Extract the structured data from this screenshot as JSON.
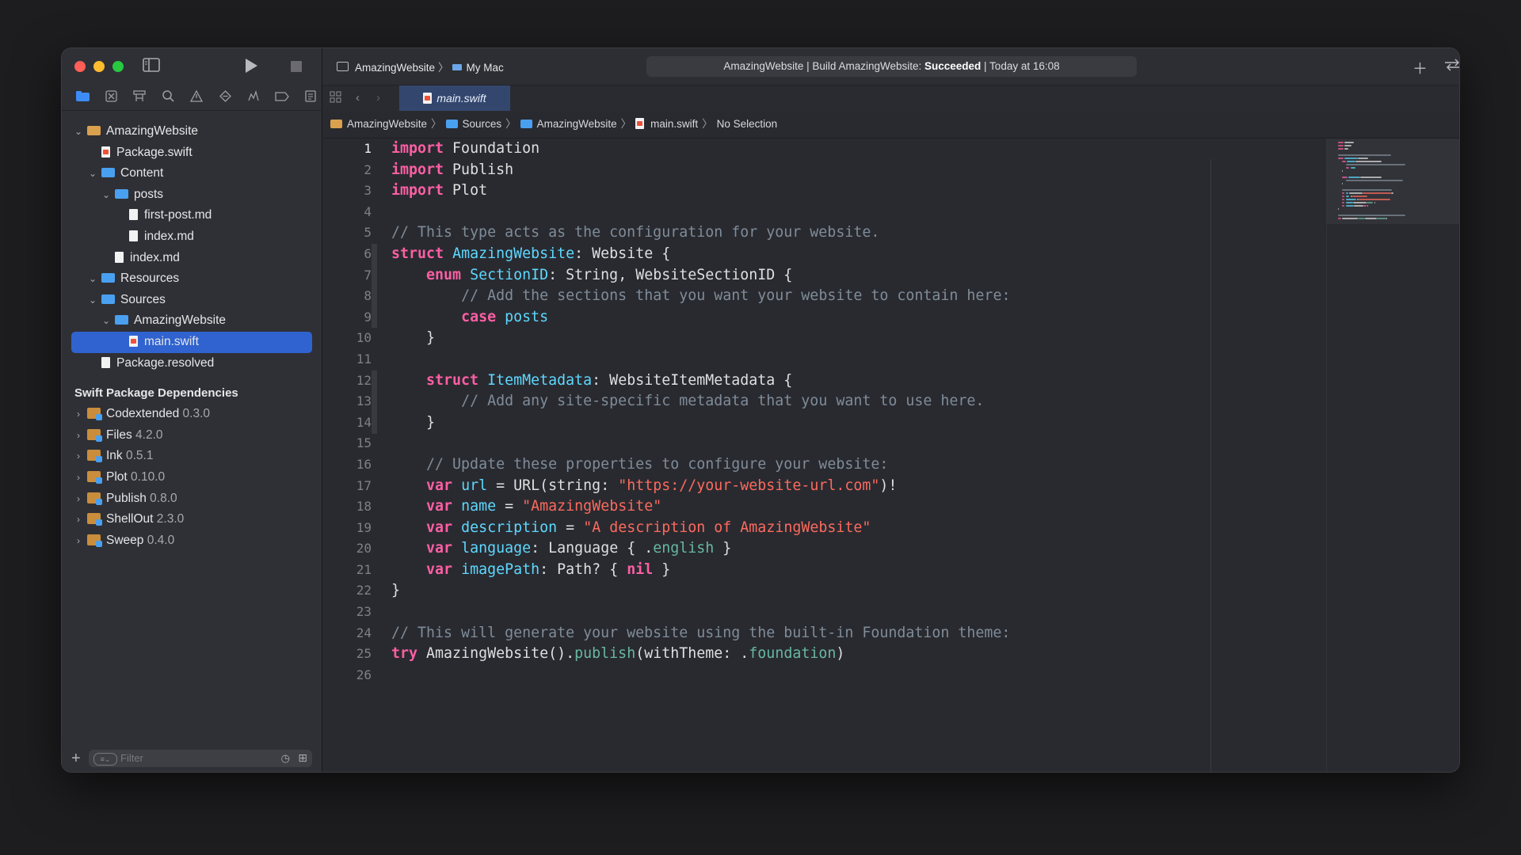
{
  "toolbar": {
    "scheme_project": "AmazingWebsite",
    "scheme_separator": "〉",
    "destination": "My Mac",
    "activity_prefix": "AmazingWebsite | Build AmazingWebsite: ",
    "activity_status": "Succeeded",
    "activity_suffix": " | Today at 16:08"
  },
  "tab": {
    "label": "main.swift"
  },
  "jumpbar": {
    "items": [
      "AmazingWebsite",
      "Sources",
      "AmazingWebsite",
      "main.swift",
      "No Selection"
    ],
    "separator": "〉"
  },
  "navigator": {
    "tree": [
      {
        "label": "AmazingWebsite",
        "kind": "project"
      },
      {
        "label": "Package.swift",
        "kind": "file"
      },
      {
        "label": "Content",
        "kind": "folder"
      },
      {
        "label": "posts",
        "kind": "folder"
      },
      {
        "label": "first-post.md",
        "kind": "file"
      },
      {
        "label": "index.md",
        "kind": "file"
      },
      {
        "label": "index.md",
        "kind": "file"
      },
      {
        "label": "Resources",
        "kind": "folder"
      },
      {
        "label": "Sources",
        "kind": "folder"
      },
      {
        "label": "AmazingWebsite",
        "kind": "folder"
      },
      {
        "label": "main.swift",
        "kind": "swift",
        "selected": true
      },
      {
        "label": "Package.resolved",
        "kind": "file"
      }
    ],
    "deps_title": "Swift Package Dependencies",
    "deps": [
      {
        "name": "Codextended",
        "version": "0.3.0"
      },
      {
        "name": "Files",
        "version": "4.2.0"
      },
      {
        "name": "Ink",
        "version": "0.5.1"
      },
      {
        "name": "Plot",
        "version": "0.10.0"
      },
      {
        "name": "Publish",
        "version": "0.8.0"
      },
      {
        "name": "ShellOut",
        "version": "2.3.0"
      },
      {
        "name": "Sweep",
        "version": "0.4.0"
      }
    ],
    "filter_placeholder": "Filter"
  },
  "editor": {
    "current_line": 1,
    "line_numbers": [
      "1",
      "2",
      "3",
      "4",
      "5",
      "6",
      "7",
      "8",
      "9",
      "10",
      "11",
      "12",
      "13",
      "14",
      "15",
      "16",
      "17",
      "18",
      "19",
      "20",
      "21",
      "22",
      "23",
      "24",
      "25",
      "26"
    ],
    "lines": [
      [
        [
          "k",
          "import"
        ],
        [
          "p",
          " Foundation"
        ]
      ],
      [
        [
          "k",
          "import"
        ],
        [
          "p",
          " Publish"
        ]
      ],
      [
        [
          "k",
          "import"
        ],
        [
          "p",
          " Plot"
        ]
      ],
      [],
      [
        [
          "c",
          "// This type acts as the configuration for your website."
        ]
      ],
      [
        [
          "k",
          "struct"
        ],
        [
          "p",
          " "
        ],
        [
          "t",
          "AmazingWebsite"
        ],
        [
          "p",
          ": Website {"
        ]
      ],
      [
        [
          "p",
          "    "
        ],
        [
          "k",
          "enum"
        ],
        [
          "p",
          " "
        ],
        [
          "t",
          "SectionID"
        ],
        [
          "p",
          ": String, WebsiteSectionID {"
        ]
      ],
      [
        [
          "p",
          "        "
        ],
        [
          "c",
          "// Add the sections that you want your website to contain here:"
        ]
      ],
      [
        [
          "p",
          "        "
        ],
        [
          "k",
          "case"
        ],
        [
          "p",
          " "
        ],
        [
          "t",
          "posts"
        ]
      ],
      [
        [
          "p",
          "    }"
        ]
      ],
      [],
      [
        [
          "p",
          "    "
        ],
        [
          "k",
          "struct"
        ],
        [
          "p",
          " "
        ],
        [
          "t",
          "ItemMetadata"
        ],
        [
          "p",
          ": WebsiteItemMetadata {"
        ]
      ],
      [
        [
          "p",
          "        "
        ],
        [
          "c",
          "// Add any site-specific metadata that you want to use here."
        ]
      ],
      [
        [
          "p",
          "    }"
        ]
      ],
      [],
      [
        [
          "p",
          "    "
        ],
        [
          "c",
          "// Update these properties to configure your website:"
        ]
      ],
      [
        [
          "p",
          "    "
        ],
        [
          "k",
          "var"
        ],
        [
          "p",
          " "
        ],
        [
          "t",
          "url"
        ],
        [
          "p",
          " = URL(string: "
        ],
        [
          "s",
          "\"https://your-website-url.com\""
        ],
        [
          "p",
          ")!"
        ]
      ],
      [
        [
          "p",
          "    "
        ],
        [
          "k",
          "var"
        ],
        [
          "p",
          " "
        ],
        [
          "t",
          "name"
        ],
        [
          "p",
          " = "
        ],
        [
          "s",
          "\"AmazingWebsite\""
        ]
      ],
      [
        [
          "p",
          "    "
        ],
        [
          "k",
          "var"
        ],
        [
          "p",
          " "
        ],
        [
          "t",
          "description"
        ],
        [
          "p",
          " = "
        ],
        [
          "s",
          "\"A description of AmazingWebsite\""
        ]
      ],
      [
        [
          "p",
          "    "
        ],
        [
          "k",
          "var"
        ],
        [
          "p",
          " "
        ],
        [
          "t",
          "language"
        ],
        [
          "p",
          ": Language { ."
        ],
        [
          "m",
          "english"
        ],
        [
          "p",
          " }"
        ]
      ],
      [
        [
          "p",
          "    "
        ],
        [
          "k",
          "var"
        ],
        [
          "p",
          " "
        ],
        [
          "t",
          "imagePath"
        ],
        [
          "p",
          ": Path? { "
        ],
        [
          "k",
          "nil"
        ],
        [
          "p",
          " }"
        ]
      ],
      [
        [
          "p",
          "}"
        ]
      ],
      [],
      [
        [
          "c",
          "// This will generate your website using the built-in Foundation theme:"
        ]
      ],
      [
        [
          "k",
          "try"
        ],
        [
          "p",
          " AmazingWebsite()."
        ],
        [
          "m",
          "publish"
        ],
        [
          "p",
          "(withTheme: ."
        ],
        [
          "m",
          "foundation"
        ],
        [
          "p",
          ")"
        ]
      ],
      []
    ],
    "token_colors": {
      "k": "#fc5fa3",
      "t": "#5dd8ff",
      "p": "#dfdfe0",
      "c": "#7f8c98",
      "s": "#fc6a5d",
      "m": "#67b7a4"
    }
  }
}
